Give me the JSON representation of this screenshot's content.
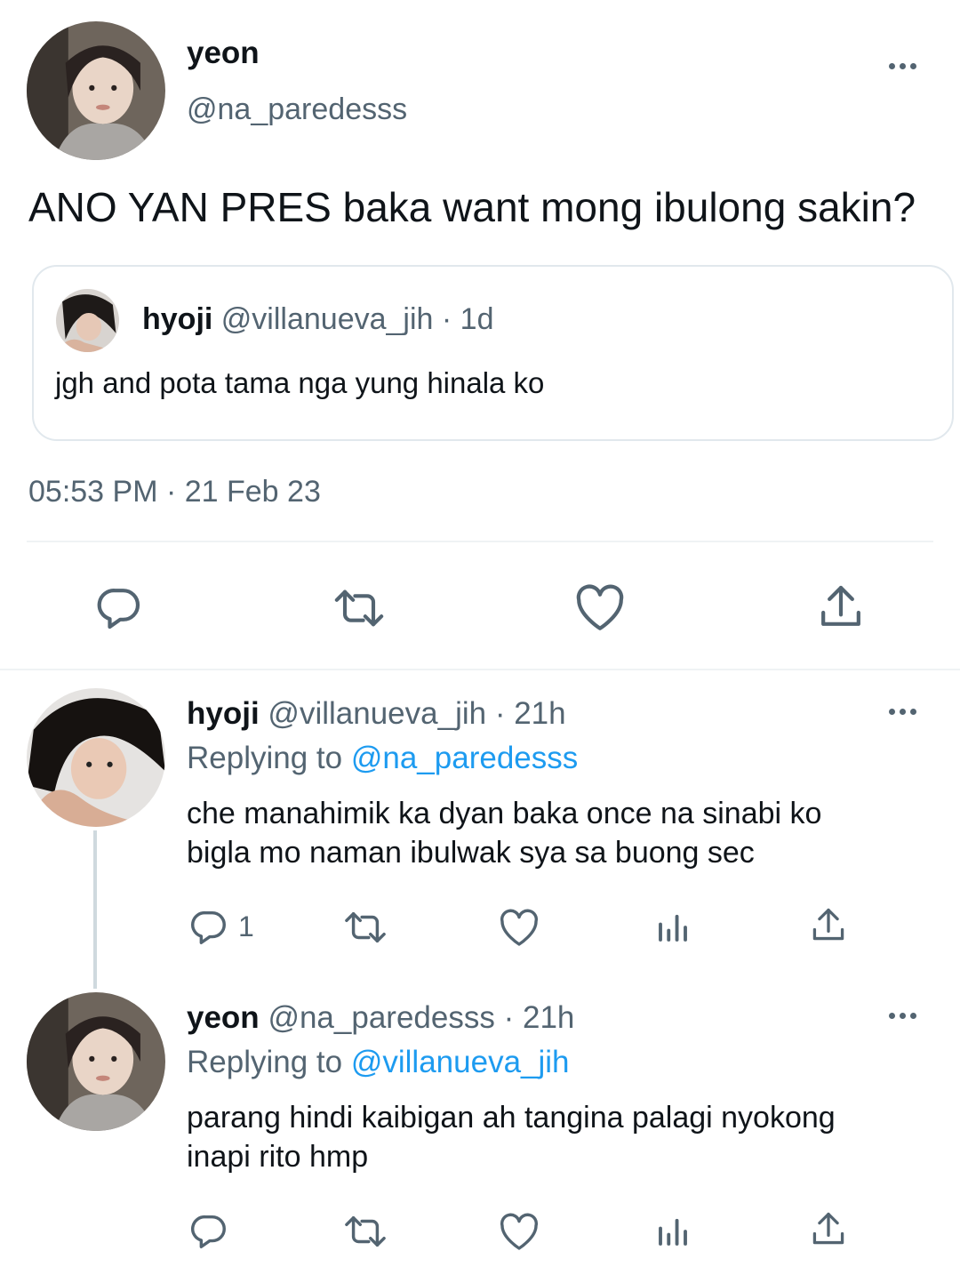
{
  "main_tweet": {
    "author_name": "yeon",
    "author_handle": "@na_paredesss",
    "text": "ANO YAN PRES baka want mong ibulong sakin?",
    "timestamp": "05:53 PM · 21 Feb 23",
    "quoted": {
      "author_name": "hyoji",
      "author_handle": "@villanueva_jih",
      "time": "· 1d",
      "text": "jgh and pota tama nga yung hinala ko"
    }
  },
  "replies": [
    {
      "author_name": "hyoji",
      "author_handle": "@villanueva_jih",
      "time": "· 21h",
      "replying_prefix": "Replying to",
      "replying_to": "@na_paredesss",
      "text_line1": "che manahimik ka dyan baka once na sinabi ko",
      "text_line2": "bigla mo naman ibulwak sya sa buong sec",
      "reply_count": "1"
    },
    {
      "author_name": "yeon",
      "author_handle": "@na_paredesss",
      "time": "· 21h",
      "replying_prefix": "Replying to",
      "replying_to": "@villanueva_jih",
      "text_line1": "parang hindi kaibigan ah tangina palagi nyokong",
      "text_line2": "inapi rito hmp",
      "reply_count": ""
    }
  ],
  "icons": {
    "more": "more-horizontal-icon",
    "reply": "reply-icon",
    "retweet": "retweet-icon",
    "like": "heart-icon",
    "views": "views-icon",
    "share": "share-icon"
  },
  "colors": {
    "text": "#0f1419",
    "secondary": "#536471",
    "link": "#1d9bf0",
    "divider": "#eff3f4"
  }
}
